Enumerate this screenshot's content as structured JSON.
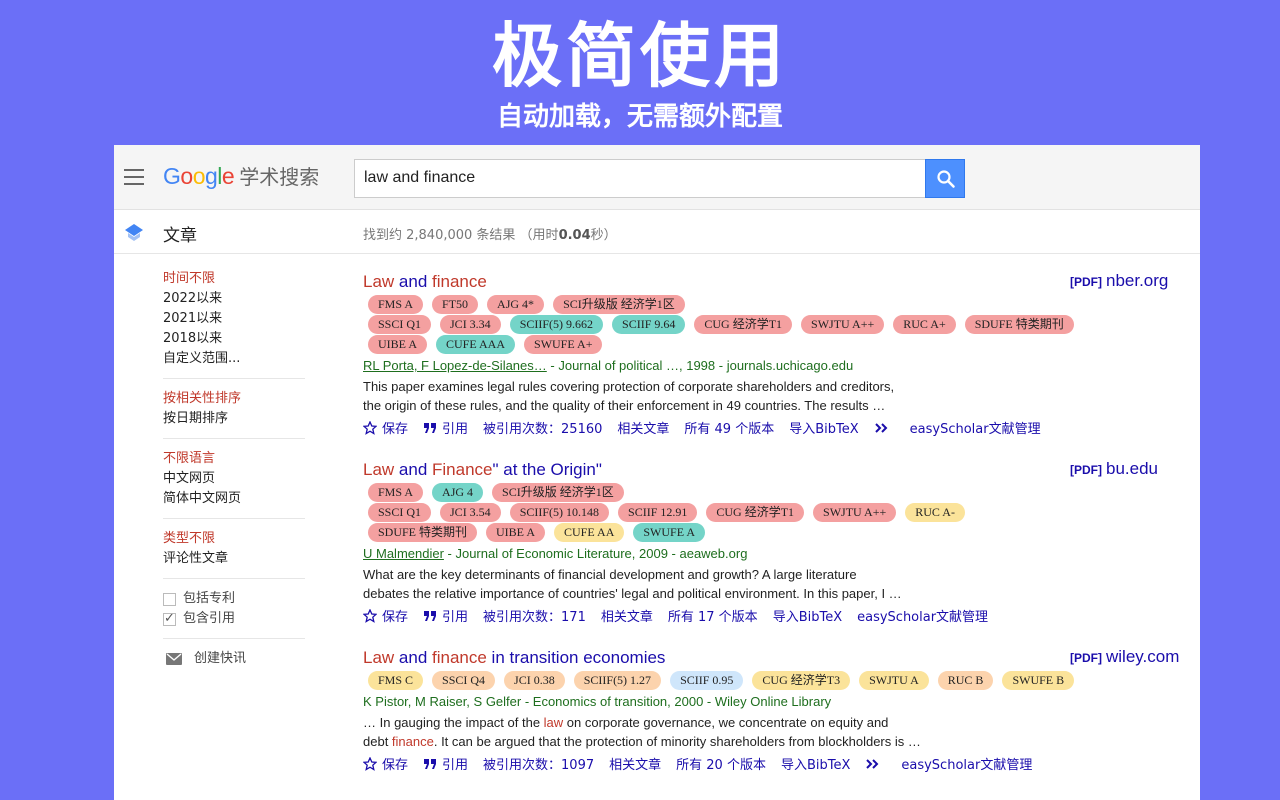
{
  "hero": {
    "title": "极简使用",
    "subtitle": "自动加载，无需额外配置"
  },
  "colors": {
    "background": "#6b6ff7",
    "link": "#1a0dab",
    "highlight": "#c0392b",
    "authors": "#1e6e1e",
    "search_button": "#4d90fe"
  },
  "header": {
    "logo_letters": [
      "G",
      "o",
      "o",
      "g",
      "l",
      "e"
    ],
    "logo_suffix": "学术搜索",
    "search_value": "law and finance",
    "menu_icon": "hamburger-icon",
    "search_icon": "magnifier-icon"
  },
  "subbar": {
    "articles_label": "文章",
    "count_prefix": "找到约 2,840,000 条结果 （用时",
    "count_time": "0.04",
    "count_suffix": "秒）"
  },
  "sidebar": {
    "time": {
      "selected": "时间不限",
      "options": [
        "2022以来",
        "2021以来",
        "2018以来",
        "自定义范围..."
      ]
    },
    "sort": {
      "selected": "按相关性排序",
      "options": [
        "按日期排序"
      ]
    },
    "lang": {
      "selected": "不限语言",
      "options": [
        "中文网页",
        "简体中文网页"
      ]
    },
    "type": {
      "selected": "类型不限",
      "options": [
        "评论性文章"
      ]
    },
    "checkboxes": [
      {
        "label": "包括专利",
        "checked": false
      },
      {
        "label": "包含引用",
        "checked": true
      }
    ],
    "alert": "创建快讯"
  },
  "results": [
    {
      "title_parts": [
        {
          "text": "Law",
          "hl": true
        },
        {
          "text": " and ",
          "hl": false
        },
        {
          "text": "finance",
          "hl": true
        }
      ],
      "pdf_label": "[PDF]",
      "source": "nber.org",
      "tags": [
        {
          "text": "FMS A",
          "color": "red"
        },
        {
          "text": "FT50",
          "color": "red"
        },
        {
          "text": "AJG 4*",
          "color": "red"
        },
        {
          "text": "SCI升级版 经济学1区",
          "color": "red"
        },
        {
          "text": "SSCI Q1",
          "color": "red"
        },
        {
          "text": "JCI 3.34",
          "color": "red"
        },
        {
          "text": "SCIIF(5) 9.662",
          "color": "teal"
        },
        {
          "text": "SCIIF 9.64",
          "color": "teal"
        },
        {
          "text": "CUG 经济学T1",
          "color": "red"
        },
        {
          "text": "SWJTU A++",
          "color": "red"
        },
        {
          "text": "RUC A+",
          "color": "red"
        },
        {
          "text": "SDUFE 特类期刊",
          "color": "red"
        },
        {
          "text": "UIBE A",
          "color": "red"
        },
        {
          "text": "CUFE AAA",
          "color": "teal"
        },
        {
          "text": "SWUFE A+",
          "color": "red"
        }
      ],
      "tag_breaks": [
        4,
        12
      ],
      "authors_linked": "RL Porta, F Lopez-de-Silanes…",
      "authors_rest": " - Journal of political …, 1998 - journals.uchicago.edu",
      "snippet": [
        [
          {
            "text": "This paper examines legal rules covering protection of corporate shareholders and creditors,",
            "hl": false
          }
        ],
        [
          {
            "text": "the origin of these rules, and the quality of their enforcement in 49 countries. The results …",
            "hl": false
          }
        ]
      ],
      "actions": [
        "保存",
        "引用",
        "被引用次数：25160",
        "相关文章",
        "所有 49 个版本",
        "导入BibTeX"
      ],
      "has_more": true,
      "extra_action": "easyScholar文献管理"
    },
    {
      "title_parts": [
        {
          "text": "Law",
          "hl": true
        },
        {
          "text": " and ",
          "hl": false
        },
        {
          "text": "Finance",
          "hl": true
        },
        {
          "text": "\" at the Origin\"",
          "hl": false
        }
      ],
      "pdf_label": "[PDF]",
      "source": "bu.edu",
      "tags": [
        {
          "text": "FMS A",
          "color": "red"
        },
        {
          "text": "AJG 4",
          "color": "teal"
        },
        {
          "text": "SCI升级版 经济学1区",
          "color": "red"
        },
        {
          "text": "SSCI Q1",
          "color": "red"
        },
        {
          "text": "JCI 3.54",
          "color": "red"
        },
        {
          "text": "SCIIF(5) 10.148",
          "color": "red"
        },
        {
          "text": "SCIIF 12.91",
          "color": "red"
        },
        {
          "text": "CUG 经济学T1",
          "color": "red"
        },
        {
          "text": "SWJTU A++",
          "color": "red"
        },
        {
          "text": "RUC A-",
          "color": "yellow"
        },
        {
          "text": "SDUFE 特类期刊",
          "color": "red"
        },
        {
          "text": "UIBE A",
          "color": "red"
        },
        {
          "text": "CUFE AA",
          "color": "yellow"
        },
        {
          "text": "SWUFE A",
          "color": "teal"
        }
      ],
      "tag_breaks": [
        3,
        10
      ],
      "authors_linked": "U Malmendier",
      "authors_rest": " - Journal of Economic Literature, 2009 - aeaweb.org",
      "snippet": [
        [
          {
            "text": "What are the key determinants of financial development and growth? A large literature",
            "hl": false
          }
        ],
        [
          {
            "text": "debates the relative importance of countries' legal and political environment. In this paper, I …",
            "hl": false
          }
        ]
      ],
      "actions": [
        "保存",
        "引用",
        "被引用次数：171",
        "相关文章",
        "所有 17 个版本",
        "导入BibTeX"
      ],
      "has_more": false,
      "extra_action": "easyScholar文献管理"
    },
    {
      "title_parts": [
        {
          "text": "Law",
          "hl": true
        },
        {
          "text": " and ",
          "hl": false
        },
        {
          "text": "finance",
          "hl": true
        },
        {
          "text": " in transition economies",
          "hl": false
        }
      ],
      "pdf_label": "[PDF]",
      "source": "wiley.com",
      "tags": [
        {
          "text": "FMS C",
          "color": "yellow"
        },
        {
          "text": "SSCI Q4",
          "color": "peach"
        },
        {
          "text": "JCI 0.38",
          "color": "peach"
        },
        {
          "text": "SCIIF(5) 1.27",
          "color": "peach"
        },
        {
          "text": "SCIIF 0.95",
          "color": "blue"
        },
        {
          "text": "CUG 经济学T3",
          "color": "yellow"
        },
        {
          "text": "SWJTU A",
          "color": "yellow"
        },
        {
          "text": "RUC B",
          "color": "peach"
        },
        {
          "text": "SWUFE B",
          "color": "yellow"
        }
      ],
      "tag_breaks": [],
      "authors_linked": "",
      "authors_rest": "K Pistor, M Raiser, S Gelfer - Economics of transition, 2000 - Wiley Online Library",
      "snippet": [
        [
          {
            "text": "… In gauging the impact of the ",
            "hl": false
          },
          {
            "text": "law",
            "hl": true
          },
          {
            "text": " on corporate governance, we concentrate on equity and",
            "hl": false
          }
        ],
        [
          {
            "text": "debt ",
            "hl": false
          },
          {
            "text": "finance",
            "hl": true
          },
          {
            "text": ". It can be argued that the protection of minority shareholders from blockholders is …",
            "hl": false
          }
        ]
      ],
      "actions": [
        "保存",
        "引用",
        "被引用次数：1097",
        "相关文章",
        "所有 20 个版本",
        "导入BibTeX"
      ],
      "has_more": true,
      "extra_action": "easyScholar文献管理"
    }
  ]
}
